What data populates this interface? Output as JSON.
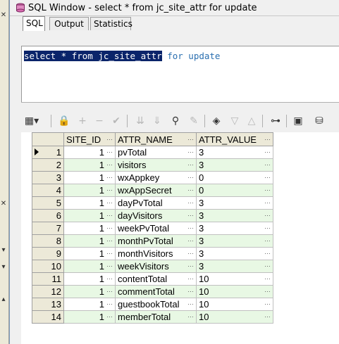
{
  "window": {
    "title": "SQL Window - select * from jc_site_attr for update"
  },
  "tabs": [
    {
      "label": "SQL",
      "active": true
    },
    {
      "label": "Output",
      "active": false
    },
    {
      "label": "Statistics",
      "active": false
    }
  ],
  "editor": {
    "selected_text": "select * from jc_site_attr",
    "rest_text": " for update"
  },
  "toolbar": {
    "icons": [
      "grid-select-icon",
      "lock-icon",
      "add-record-icon",
      "delete-record-icon",
      "post-icon",
      "next-page-icon",
      "last-page-icon",
      "find-icon",
      "clear-icon",
      "query-by-example-icon",
      "sort-desc-icon",
      "sort-asc-icon",
      "tree-icon",
      "save-icon",
      "export-icon"
    ]
  },
  "grid": {
    "columns": [
      "SITE_ID",
      "ATTR_NAME",
      "ATTR_VALUE"
    ],
    "rows": [
      {
        "n": "1",
        "site_id": "1",
        "attr_name": "pvTotal",
        "attr_value": "3"
      },
      {
        "n": "2",
        "site_id": "1",
        "attr_name": "visitors",
        "attr_value": "3"
      },
      {
        "n": "3",
        "site_id": "1",
        "attr_name": "wxAppkey",
        "attr_value": "0"
      },
      {
        "n": "4",
        "site_id": "1",
        "attr_name": "wxAppSecret",
        "attr_value": "0"
      },
      {
        "n": "5",
        "site_id": "1",
        "attr_name": "dayPvTotal",
        "attr_value": "3"
      },
      {
        "n": "6",
        "site_id": "1",
        "attr_name": "dayVisitors",
        "attr_value": "3"
      },
      {
        "n": "7",
        "site_id": "1",
        "attr_name": "weekPvTotal",
        "attr_value": "3"
      },
      {
        "n": "8",
        "site_id": "1",
        "attr_name": "monthPvTotal",
        "attr_value": "3"
      },
      {
        "n": "9",
        "site_id": "1",
        "attr_name": "monthVisitors",
        "attr_value": "3"
      },
      {
        "n": "10",
        "site_id": "1",
        "attr_name": "weekVisitors",
        "attr_value": "3"
      },
      {
        "n": "11",
        "site_id": "1",
        "attr_name": "contentTotal",
        "attr_value": "10"
      },
      {
        "n": "12",
        "site_id": "1",
        "attr_name": "commentTotal",
        "attr_value": "10"
      },
      {
        "n": "13",
        "site_id": "1",
        "attr_name": "guestbookTotal",
        "attr_value": "10"
      },
      {
        "n": "14",
        "site_id": "1",
        "attr_name": "memberTotal",
        "attr_value": "10"
      }
    ]
  },
  "colors": {
    "selection": "#0a246a",
    "alt_row": "#e8f8e4",
    "keyword": "#2a6fb0"
  }
}
